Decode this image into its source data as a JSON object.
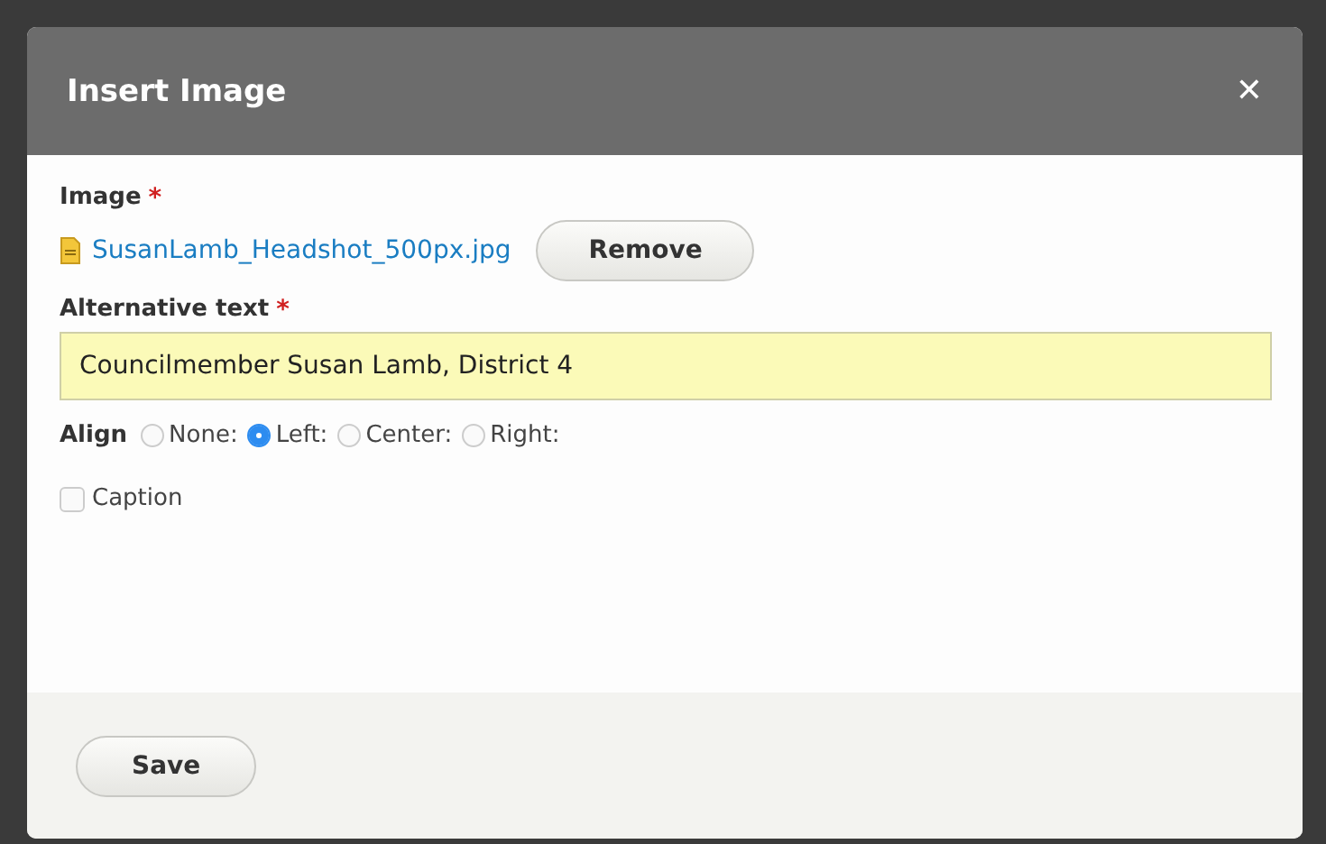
{
  "dialog": {
    "title": "Insert Image",
    "close": "✕"
  },
  "image_field": {
    "label": "Image",
    "required_mark": "*",
    "file_name": "SusanLamb_Headshot_500px.jpg",
    "remove_button": "Remove"
  },
  "alt_field": {
    "label": "Alternative text",
    "required_mark": "*",
    "value": "Councilmember Susan Lamb, District 4"
  },
  "align": {
    "label": "Align",
    "options": [
      {
        "label": "None:",
        "selected": false
      },
      {
        "label": "Left:",
        "selected": true
      },
      {
        "label": "Center:",
        "selected": false
      },
      {
        "label": "Right:",
        "selected": false
      }
    ]
  },
  "caption": {
    "label": "Caption",
    "checked": false
  },
  "buttons": [
    "Save"
  ]
}
